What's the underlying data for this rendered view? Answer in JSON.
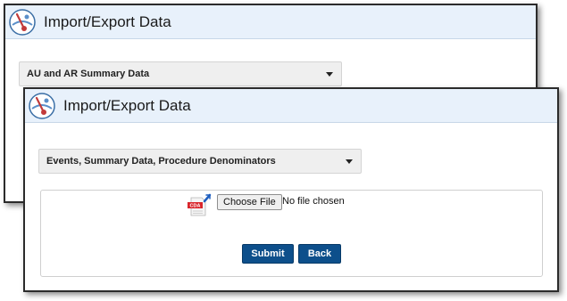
{
  "back_panel": {
    "title": "Import/Export Data",
    "select": {
      "selected": "AU and AR Summary Data"
    }
  },
  "front_panel": {
    "title": "Import/Export Data",
    "select": {
      "selected": "Events, Summary Data, Procedure Denominators"
    },
    "upload": {
      "file_type_label": "CDA",
      "choose_file_label": "Choose File",
      "file_status": "No file chosen"
    },
    "buttons": {
      "submit": "Submit",
      "back": "Back"
    }
  },
  "colors": {
    "header_bg": "#e8f1fb",
    "button_bg": "#0d4f8b",
    "cda_icon": "#d9262c"
  },
  "icons": {
    "logo": "cdc-nhsn-logo-icon",
    "file_type": "cda-file-icon",
    "dropdown": "caret-down-icon"
  }
}
